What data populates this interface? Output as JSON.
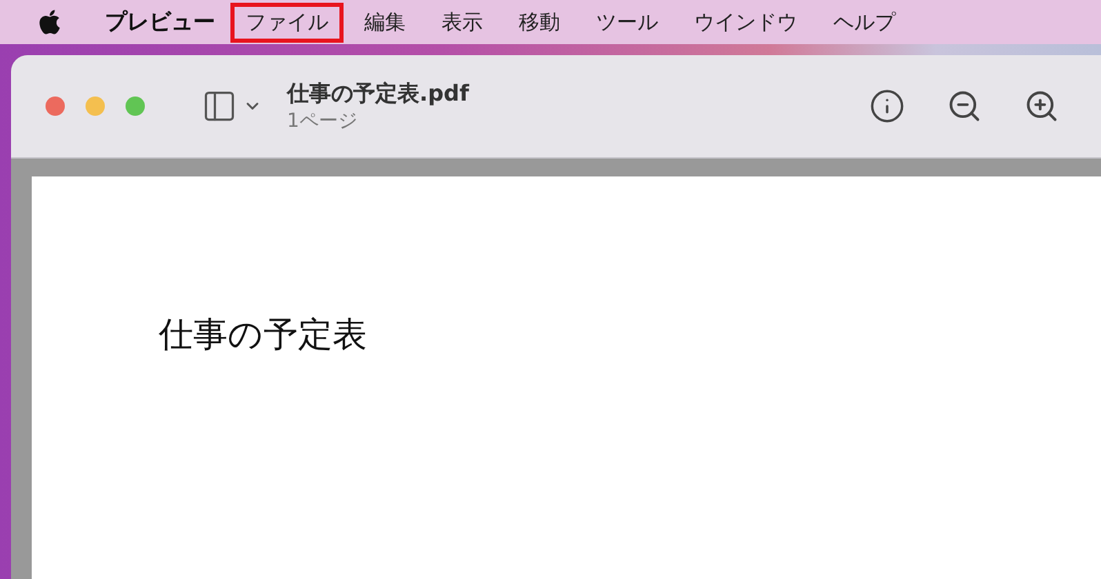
{
  "menu_bar": {
    "app_name": "プレビュー",
    "items": [
      {
        "label": "ファイル",
        "highlighted": true
      },
      {
        "label": "編集",
        "highlighted": false
      },
      {
        "label": "表示",
        "highlighted": false
      },
      {
        "label": "移動",
        "highlighted": false
      },
      {
        "label": "ツール",
        "highlighted": false
      },
      {
        "label": "ウインドウ",
        "highlighted": false
      },
      {
        "label": "ヘルプ",
        "highlighted": false
      }
    ]
  },
  "window": {
    "title": "仕事の予定表.pdf",
    "subtitle": "1ページ"
  },
  "document": {
    "heading": "仕事の予定表"
  }
}
